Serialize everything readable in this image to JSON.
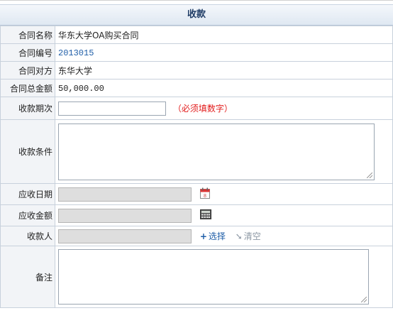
{
  "header": {
    "title": "收款"
  },
  "rows": {
    "contract_name": {
      "label": "合同名称",
      "value": "华东大学OA购买合同"
    },
    "contract_no": {
      "label": "合同编号",
      "value": "2013015"
    },
    "counterparty": {
      "label": "合同对方",
      "value": "东华大学"
    },
    "total_amount": {
      "label": "合同总金额",
      "value": "50,000.00"
    },
    "installment": {
      "label": "收款期次",
      "value": "",
      "hint": "（必须填数字）"
    },
    "conditions": {
      "label": "收款条件",
      "value": ""
    },
    "due_date": {
      "label": "应收日期",
      "value": ""
    },
    "due_amount": {
      "label": "应收金额",
      "value": ""
    },
    "payee": {
      "label": "收款人",
      "value": "",
      "select_label": "选择",
      "clear_label": "清空"
    },
    "remarks": {
      "label": "备注",
      "value": ""
    }
  },
  "icons": {
    "calendar": "calendar-icon",
    "calculator": "calculator-icon",
    "add": "plus-icon",
    "clear": "clear-icon"
  },
  "colors": {
    "hint": "#e21b1b",
    "link": "#1f5ea8",
    "header_text": "#1f3c66"
  }
}
